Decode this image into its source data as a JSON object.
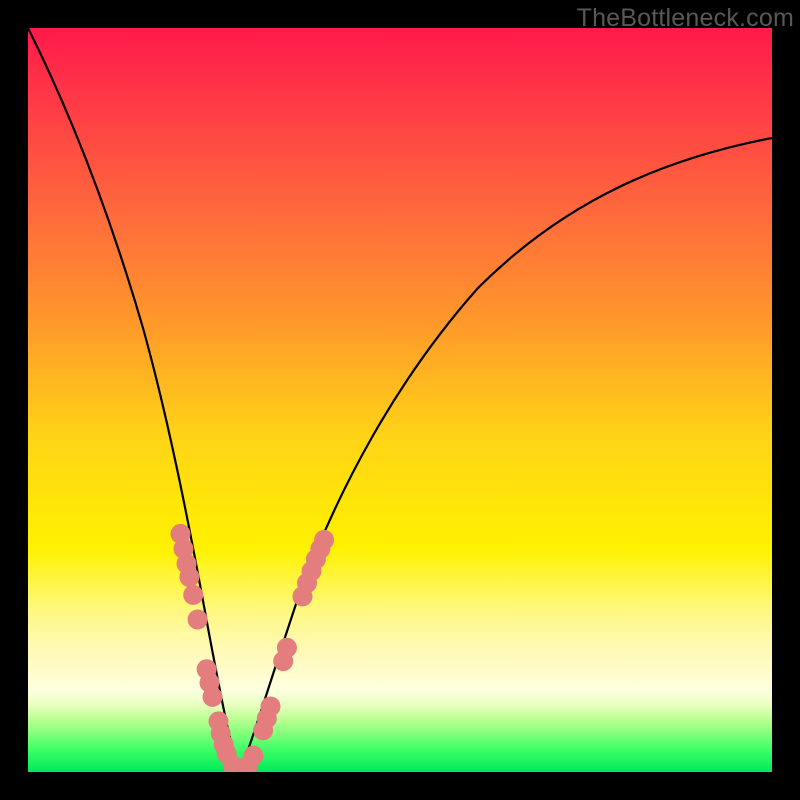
{
  "domain": "Chart",
  "watermark": "TheBottleneck.com",
  "chart_data": {
    "type": "line",
    "title": "",
    "xlabel": "",
    "ylabel": "",
    "x_range": [
      0,
      100
    ],
    "y_range": [
      0,
      100
    ],
    "y_inverted_display": true,
    "background": "rainbow-heat-gradient",
    "description": "V-shaped bottleneck curve chart with color gradient from red (bad, top) through yellow to green (good, bottom). Two black curves meet near the bottom. Salmon-colored data point clusters sit along the lower portion of each curve near the valley.",
    "series": [
      {
        "name": "left-curve",
        "points_xy": [
          [
            0,
            100
          ],
          [
            4,
            93
          ],
          [
            8,
            82
          ],
          [
            12,
            70
          ],
          [
            15,
            58
          ],
          [
            17,
            47
          ],
          [
            19,
            36
          ],
          [
            21,
            26
          ],
          [
            23,
            16
          ],
          [
            25,
            8
          ],
          [
            27,
            2
          ],
          [
            28.5,
            0
          ]
        ]
      },
      {
        "name": "right-curve",
        "points_xy": [
          [
            28.5,
            0
          ],
          [
            30,
            2
          ],
          [
            33,
            10
          ],
          [
            36,
            19
          ],
          [
            40,
            30
          ],
          [
            46,
            42
          ],
          [
            54,
            54
          ],
          [
            62,
            62
          ],
          [
            72,
            70
          ],
          [
            84,
            77
          ],
          [
            100,
            84
          ]
        ]
      }
    ],
    "point_clusters": [
      {
        "name": "left-cluster",
        "color": "#e47d7d",
        "points_xy": [
          [
            20.5,
            32
          ],
          [
            20.9,
            30
          ],
          [
            21.3,
            28
          ],
          [
            21.7,
            26.2
          ],
          [
            22.2,
            23.8
          ],
          [
            22.8,
            20.5
          ],
          [
            24.0,
            13.8
          ],
          [
            24.4,
            12
          ],
          [
            24.8,
            10.1
          ],
          [
            25.6,
            6.8
          ],
          [
            25.9,
            5.2
          ],
          [
            26.3,
            3.7
          ],
          [
            26.7,
            2.5
          ],
          [
            27.5,
            0.9
          ],
          [
            28.2,
            0.2
          ]
        ]
      },
      {
        "name": "right-cluster",
        "color": "#e47d7d",
        "points_xy": [
          [
            28.9,
            0.2
          ],
          [
            29.6,
            0.9
          ],
          [
            30.3,
            2.2
          ],
          [
            31.6,
            5.6
          ],
          [
            32.1,
            7.2
          ],
          [
            32.6,
            8.8
          ],
          [
            34.3,
            14.9
          ],
          [
            34.8,
            16.7
          ],
          [
            36.9,
            23.6
          ],
          [
            37.5,
            25.4
          ],
          [
            38.1,
            27.0
          ],
          [
            38.7,
            28.6
          ],
          [
            39.3,
            30.0
          ],
          [
            39.8,
            31.2
          ]
        ]
      }
    ]
  }
}
